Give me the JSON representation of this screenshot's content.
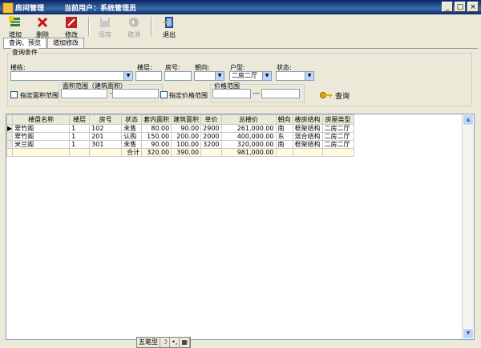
{
  "window": {
    "title": "房间管理",
    "current_user": "当前用户：系统管理员",
    "controls": [
      "_",
      "□",
      "×"
    ]
  },
  "toolbar": {
    "buttons": [
      {
        "label": "增加",
        "icon": "add-icon",
        "enabled": true
      },
      {
        "label": "删除",
        "icon": "delete-icon",
        "enabled": true
      },
      {
        "label": "修改",
        "icon": "edit-icon",
        "enabled": true
      },
      {
        "label": "保存",
        "icon": "save-icon",
        "enabled": false
      },
      {
        "label": "取消",
        "icon": "undo-icon",
        "enabled": false
      },
      {
        "label": "退出",
        "icon": "exit-icon",
        "enabled": true
      }
    ]
  },
  "tabs": [
    {
      "label": "查询、预览",
      "active": true
    },
    {
      "label": "增加修改",
      "active": false
    }
  ],
  "query": {
    "group_title": "查询条件",
    "building_label": "楼栋:",
    "building_value": "",
    "floor_label": "楼层:",
    "floor_value": "",
    "room_label": "房号:",
    "room_value": "",
    "direction_label": "朝向:",
    "direction_value": "",
    "layout_label": "户型:",
    "layout_value": "二房二厅",
    "status_label": "状态:",
    "status_value": "",
    "area_check_label": "指定面积范围",
    "area_range_label": "面积范围（建筑面积）",
    "area_from": "",
    "area_to": "",
    "range_dash": "---",
    "price_check_label": "指定价格范围",
    "price_range_label": "价格范围",
    "price_from": "",
    "price_to": "",
    "search_label": "查询",
    "search_icon": "key-icon"
  },
  "table": {
    "columns": [
      "楼盘名称",
      "楼层",
      "房号",
      "状态",
      "套内面积",
      "建筑面积",
      "单价",
      "总楼价",
      "朝向",
      "楼房结构",
      "房屋类型"
    ],
    "rows": [
      [
        "翠竹阁",
        "1",
        "102",
        "未售",
        "80.00",
        "90.00",
        "2900",
        "261,000.00",
        "南",
        "框架结构",
        "二房二厅"
      ],
      [
        "翠竹阁",
        "1",
        "201",
        "认购",
        "150.00",
        "200.00",
        "2000",
        "400,000.00",
        "东",
        "混合结构",
        "二房二厅"
      ],
      [
        "米兰阁",
        "1",
        "301",
        "未售",
        "90.00",
        "100.00",
        "3200",
        "320,000.00",
        "南",
        "框架结构",
        "二房二厅"
      ]
    ],
    "total": [
      "",
      "",
      "",
      "合计",
      "320.00",
      "390.00",
      "",
      "981,000.00",
      "",
      "",
      ""
    ]
  },
  "ime_bar": [
    "五笔型",
    "☽",
    "•,",
    "▦"
  ],
  "colors": {
    "titlebar": "#0A246A",
    "face": "#ECE9D8"
  }
}
